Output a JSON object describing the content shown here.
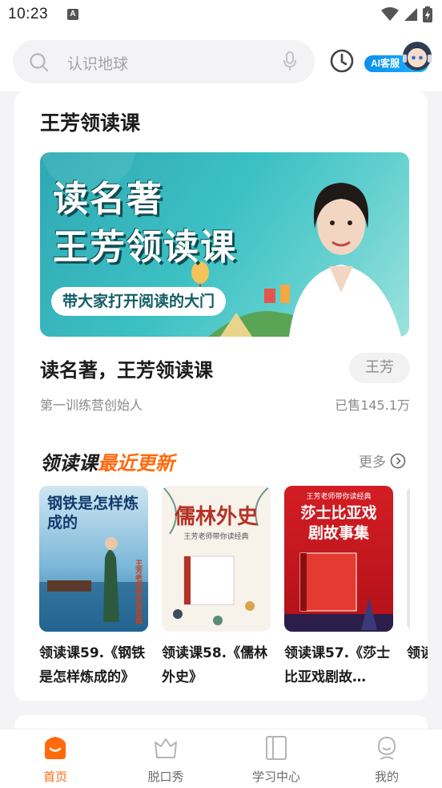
{
  "status_bar": {
    "time": "10:23",
    "notification_icon": "A"
  },
  "search": {
    "placeholder": "认识地球"
  },
  "ai_service": {
    "label": "AI客服"
  },
  "featured": {
    "section_title": "王芳领读课",
    "banner": {
      "line1": "读名著",
      "line2": "王芳领读课",
      "subtitle": "带大家打开阅读的大门"
    },
    "course_title": "读名著，王芳领读课",
    "teacher_tag": "王芳",
    "course_subtitle": "第一训练营创始人",
    "sold_count": "已售145.1万"
  },
  "recent": {
    "title_part1": "领读课",
    "title_part2": "最近更新",
    "more_label": "更多",
    "books": [
      {
        "title": "领读课59.《钢铁是怎样炼成的》",
        "cover_text": "钢铁是怎样炼成的",
        "cover_side_text": "王芳老师带你读经典"
      },
      {
        "title": "领读课58.《儒林外史》",
        "cover_text": "儒林外史",
        "cover_sub_text": "王芳老师带你读经典"
      },
      {
        "title": "领读课57.《莎士比亚戏剧故…",
        "cover_top_text": "王芳老师带你读经典",
        "cover_text": "莎士比亚戏剧故事集"
      },
      {
        "title": "领读课…"
      }
    ]
  },
  "bottom_nav": [
    {
      "label": "首页",
      "icon": "home-icon",
      "active": true
    },
    {
      "label": "脱口秀",
      "icon": "crown-icon",
      "active": false
    },
    {
      "label": "学习中心",
      "icon": "book-icon",
      "active": false
    },
    {
      "label": "我的",
      "icon": "profile-icon",
      "active": false
    }
  ],
  "colors": {
    "accent": "#ff6a0d",
    "ai_blue": "#0a8ff0",
    "banner_teal": "#3cc0c3"
  }
}
